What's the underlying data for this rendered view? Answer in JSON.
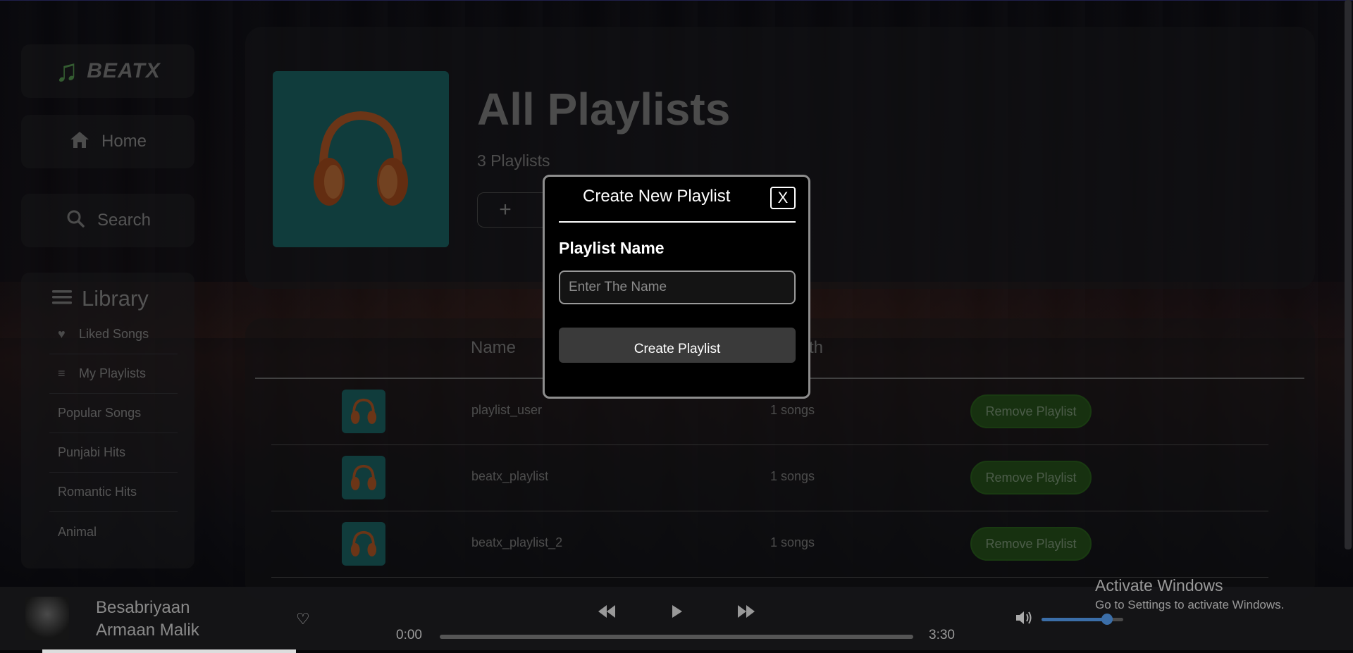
{
  "app": {
    "logo_text": "BEATX"
  },
  "sidebar": {
    "home_label": "Home",
    "search_label": "Search",
    "library_label": "Library",
    "items": [
      {
        "label": "Liked Songs",
        "icon": "heart-icon"
      },
      {
        "label": "My Playlists",
        "icon": "list-icon"
      },
      {
        "label": "Popular Songs"
      },
      {
        "label": "Punjabi Hits"
      },
      {
        "label": "Romantic Hits"
      },
      {
        "label": "Animal"
      }
    ]
  },
  "header": {
    "title": "All Playlists",
    "subtitle": "3 Playlists",
    "add_label": "+"
  },
  "table": {
    "columns": [
      "Name",
      "th"
    ],
    "rows": [
      {
        "name": "playlist_user",
        "length": "1 songs",
        "action": "Remove Playlist"
      },
      {
        "name": "beatx_playlist",
        "length": "1 songs",
        "action": "Remove Playlist"
      },
      {
        "name": "beatx_playlist_2",
        "length": "1 songs",
        "action": "Remove Playlist"
      }
    ]
  },
  "modal": {
    "title": "Create New Playlist",
    "close_label": "X",
    "field_label": "Playlist Name",
    "input_placeholder": "Enter The Name",
    "input_value": "",
    "submit_label": "Create Playlist"
  },
  "player": {
    "song_title": "Besabriyaan",
    "artist": "Armaan Malik",
    "current_time": "0:00",
    "total_time": "3:30",
    "progress": 0,
    "volume": 0.8
  },
  "system": {
    "activate_title": "Activate Windows",
    "activate_sub": "Go to Settings to activate Windows."
  },
  "colors": {
    "accent_green": "#2b5a1e",
    "cover_teal": "#1e6e6e",
    "volume_blue": "#3b6ea8"
  }
}
